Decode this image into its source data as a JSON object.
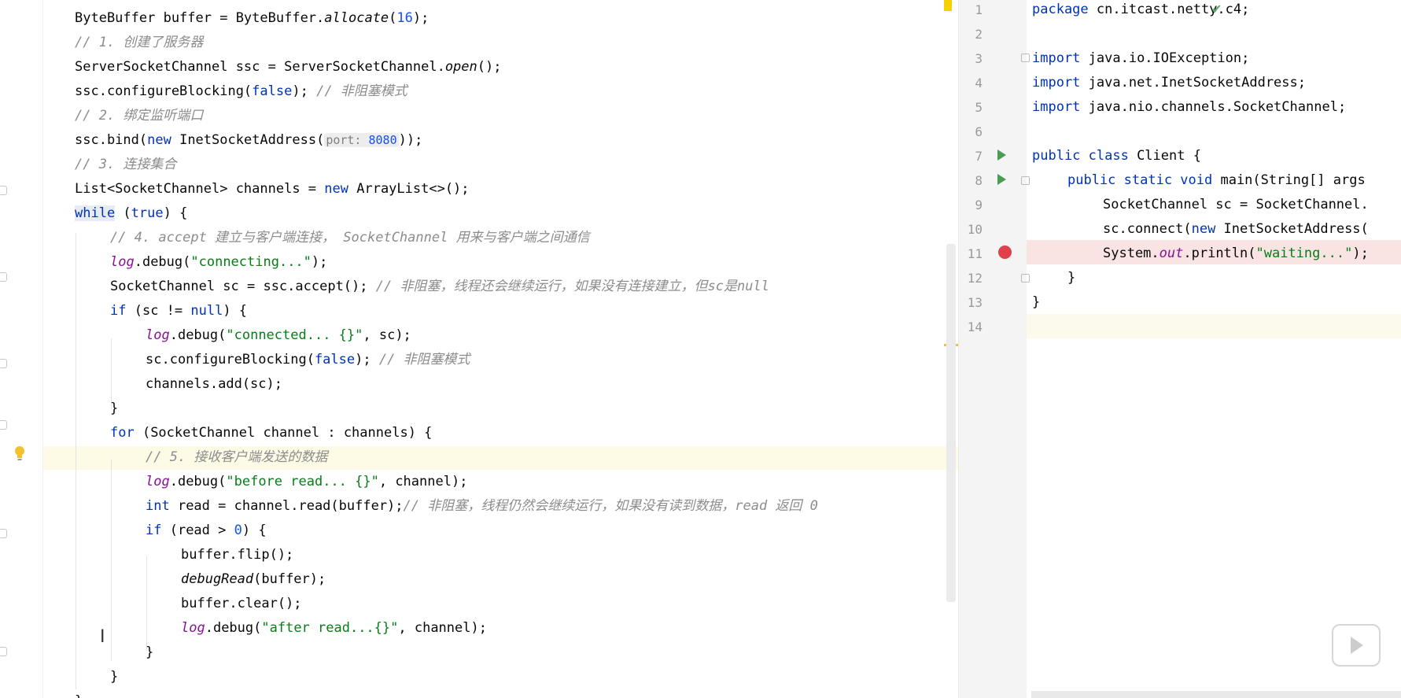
{
  "left_editor": {
    "lines": {
      "l01": "ByteBuffer buffer = ByteBuffer.",
      "l01_call": "allocate",
      "l01_arg": "16",
      "l01_end": ");",
      "l02": "// 1. 创建了服务器",
      "l03_a": "ServerSocketChannel ssc = ServerSocketChannel.",
      "l03_call": "open",
      "l03_end": "();",
      "l04_a": "ssc.configureBlocking(",
      "l04_kw": "false",
      "l04_b": "); ",
      "l04_c": "// 非阻塞模式",
      "l05": "// 2. 绑定监听端口",
      "l06_a": "ssc.bind(",
      "l06_kw": "new",
      "l06_b": " InetSocketAddress(",
      "l06_hint": "port:",
      "l06_num": "8080",
      "l06_end": "));",
      "l07": "// 3. 连接集合",
      "l08_a": "List<SocketChannel> channels = ",
      "l08_kw": "new",
      "l08_b": " ArrayList<>();",
      "l09_kw": "while",
      "l09_a": " (",
      "l09_kw2": "true",
      "l09_b": ") {",
      "l10": "// 4. accept 建立与客户端连接， SocketChannel 用来与客户端之间通信",
      "l11_f": "log",
      "l11_a": ".debug(",
      "l11_s": "\"connecting...\"",
      "l11_end": ");",
      "l12_a": "SocketChannel sc = ssc.accept(); ",
      "l12_c": "// 非阻塞，线程还会继续运行，如果没有连接建立，但sc是null",
      "l13_kw": "if",
      "l13_a": " (sc != ",
      "l13_kw2": "null",
      "l13_b": ") {",
      "l14_f": "log",
      "l14_a": ".debug(",
      "l14_s": "\"connected... {}\"",
      "l14_end": ", sc);",
      "l15_a": "sc.configureBlocking(",
      "l15_kw": "false",
      "l15_b": "); ",
      "l15_c": "// 非阻塞模式",
      "l16": "channels.add(sc);",
      "l17": "}",
      "l18_kw": "for",
      "l18_a": " (SocketChannel channel : channels) {",
      "l19": "// 5. 接收客户端发送的数据",
      "l20_f": "log",
      "l20_a": ".debug(",
      "l20_s": "\"before read... {}\"",
      "l20_end": ", channel);",
      "l21_kw": "int",
      "l21_a": " read = channel.read(buffer);",
      "l21_c": "// 非阻塞，线程仍然会继续运行，如果没有读到数据，read 返回 0",
      "l22_kw": "if",
      "l22_a": " (read > ",
      "l22_num": "0",
      "l22_b": ") {",
      "l23": "buffer.flip();",
      "l24_call": "debugRead",
      "l24_a": "(buffer);",
      "l25": "buffer.clear();",
      "l26_f": "log",
      "l26_a": ".debug(",
      "l26_s": "\"after read...{}\"",
      "l26_end": ", channel);",
      "l27": "}",
      "l28": "}",
      "l29": "}"
    }
  },
  "right_editor": {
    "line_numbers": [
      "1",
      "2",
      "3",
      "4",
      "5",
      "6",
      "7",
      "8",
      "9",
      "10",
      "11",
      "12",
      "13",
      "14"
    ],
    "lines": {
      "r01_kw": "package",
      "r01_a": " cn.itcast.netty.c4;",
      "r03_kw": "import",
      "r03_a": " java.io.IOException;",
      "r04_kw": "import",
      "r04_a": " java.net.InetSocketAddress;",
      "r05_kw": "import",
      "r05_a": " java.nio.channels.SocketChannel;",
      "r07_kw": "public class",
      "r07_a": " Client {",
      "r08_kw": "public static void",
      "r08_a": " main(String[] args",
      "r09": "SocketChannel sc = SocketChannel.",
      "r10_a": "sc.connect(",
      "r10_kw": "new",
      "r10_b": " InetSocketAddress(",
      "r11_a": "System.",
      "r11_f": "out",
      "r11_b": ".println(",
      "r11_s": "\"waiting...\"",
      "r11_end": ");",
      "r12": "}",
      "r13": "}"
    }
  },
  "colors": {
    "keyword": "#0033b3",
    "comment": "#8c8c8c",
    "string": "#067d17",
    "number": "#1750eb",
    "field": "#871094",
    "breakpoint": "#e0404a",
    "run_gutter": "#499c54"
  },
  "icons": [
    "lightbulb-icon",
    "run-icon",
    "breakpoint-icon",
    "checkmark-icon",
    "text-cursor-icon",
    "play-icon",
    "fold-icon"
  ]
}
